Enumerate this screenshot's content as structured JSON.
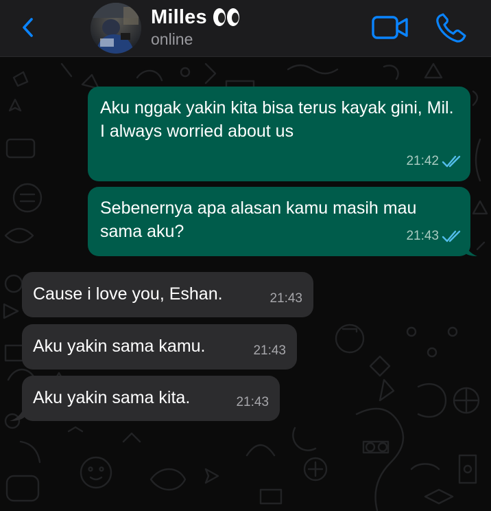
{
  "header": {
    "contact_name": "Milles",
    "status": "online",
    "background": "#1c1c1e",
    "accent": "#0a84ff"
  },
  "icons": {
    "back": "chevron-left-icon",
    "video": "video-camera-icon",
    "call": "phone-icon",
    "emoji": "eyes-emoji",
    "read_receipt": "double-check-icon"
  },
  "messages": [
    {
      "direction": "outgoing",
      "text": "Aku nggak yakin kita bisa terus kayak gini, Mil. I always worried about us",
      "time": "21:42",
      "read": true
    },
    {
      "direction": "outgoing",
      "text": "Sebenernya apa alasan kamu masih mau sama aku?",
      "time": "21:43",
      "read": true
    },
    {
      "direction": "incoming",
      "text": "Cause i love you, Eshan.",
      "time": "21:43"
    },
    {
      "direction": "incoming",
      "text": "Aku yakin sama kamu.",
      "time": "21:43"
    },
    {
      "direction": "incoming",
      "text": "Aku yakin sama kita.",
      "time": "21:43"
    }
  ],
  "colors": {
    "outgoing_bubble": "#005c4b",
    "incoming_bubble": "#2c2c2e",
    "chat_background": "#0b0b0b",
    "read_tick": "#53bdeb"
  }
}
